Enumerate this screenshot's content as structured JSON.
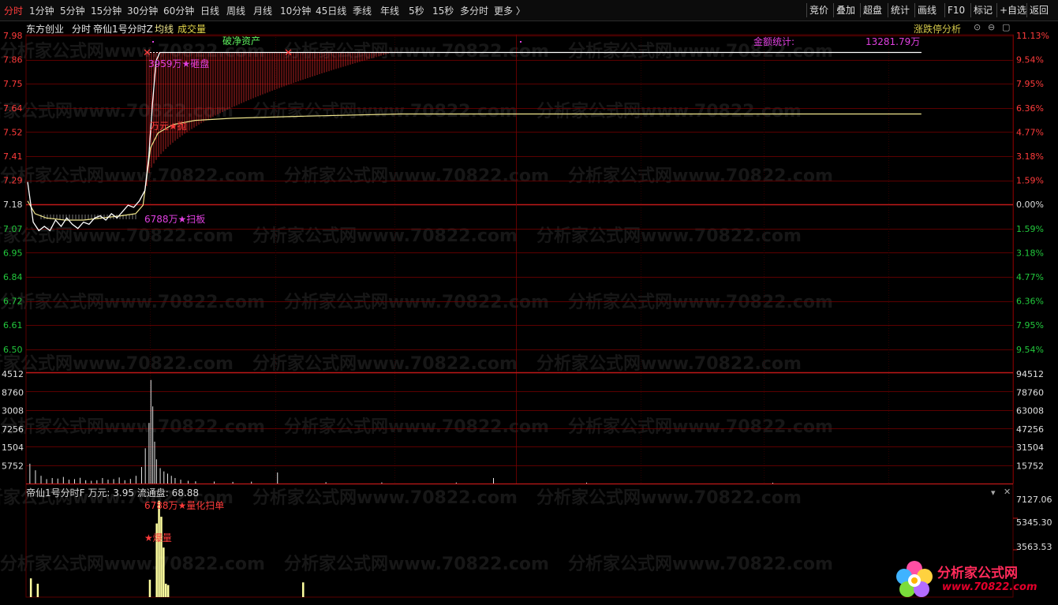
{
  "toolbar": {
    "periods": [
      {
        "label": "分时",
        "active": true
      },
      {
        "label": "1分钟"
      },
      {
        "label": "5分钟"
      },
      {
        "label": "15分钟"
      },
      {
        "label": "30分钟"
      },
      {
        "label": "60分钟"
      },
      {
        "label": "日线"
      },
      {
        "label": "周线"
      },
      {
        "label": "月线"
      },
      {
        "label": "10分钟"
      },
      {
        "label": "45日线"
      },
      {
        "label": "季线"
      },
      {
        "label": "年线"
      },
      {
        "label": "5秒"
      },
      {
        "label": "15秒"
      },
      {
        "label": "多分时"
      },
      {
        "label": "更多 〉"
      }
    ],
    "right_buttons": [
      "竞价",
      "叠加",
      "超盘",
      "统计",
      "画线",
      "F10",
      "标记",
      "+自选",
      "返回"
    ]
  },
  "info": {
    "stock_name": "东方创业",
    "view": "分时",
    "indicator": "帝仙1号分时Z",
    "avg_label": "均线",
    "vol_label": "成交量",
    "right_label": "涨跌停分析"
  },
  "price_axis": {
    "left": [
      "7.98",
      "7.86",
      "7.75",
      "7.64",
      "7.52",
      "7.41",
      "7.29",
      "7.18",
      "7.07",
      "6.95",
      "6.84",
      "6.72",
      "6.61",
      "6.50"
    ],
    "right": [
      "11.13%",
      "9.54%",
      "7.95%",
      "6.36%",
      "4.77%",
      "3.18%",
      "1.59%",
      "0.00%",
      "1.59%",
      "3.18%",
      "4.77%",
      "6.36%",
      "7.95%",
      "9.54%"
    ],
    "prev_close": 7.18
  },
  "volume_axis": {
    "left": [
      "4512",
      "8760",
      "3008",
      "7256",
      "1504",
      "5752"
    ],
    "right": [
      "94512",
      "78760",
      "63008",
      "47256",
      "31504",
      "15752"
    ]
  },
  "sub_axis": {
    "right": [
      "7127.06",
      "5345.30",
      "3563.53"
    ]
  },
  "annotations": {
    "top_sell": "3959万★砸盘",
    "mid_sell": "万元★抛",
    "sweep": "6788万★扫板",
    "break_net": "破净资产",
    "amount_label": "金额统计:",
    "amount_value": "13281.79万",
    "sub_sweep": "6788万★量化扫单",
    "sub_burst": "★爆量"
  },
  "sub_header": {
    "name": "帝仙1号分时F",
    "unit_label": "万元:",
    "unit_value": "3.95",
    "float_label": "流通盘:",
    "float_value": "68.88"
  },
  "watermark": "分析家公式网www.70822.com",
  "logo": {
    "line1": "分析家公式网",
    "line2": "www.70822.com"
  },
  "colors": {
    "up": "#ff3b3b",
    "down": "#22c83c",
    "grid": "#7a0000",
    "price": "#ffffff",
    "avg": "#f0e68c",
    "magenta": "#e040e0"
  },
  "chart_data": {
    "type": "line",
    "x_index_range": [
      0,
      240
    ],
    "prev_close": 7.18,
    "ylim": [
      6.5,
      7.98
    ],
    "series": [],
    "price_points": [
      [
        0,
        7.29
      ],
      [
        3,
        7.1
      ],
      [
        6,
        7.06
      ],
      [
        9,
        7.08
      ],
      [
        12,
        7.06
      ],
      [
        15,
        7.11
      ],
      [
        18,
        7.08
      ],
      [
        21,
        7.12
      ],
      [
        24,
        7.09
      ],
      [
        27,
        7.07
      ],
      [
        30,
        7.1
      ],
      [
        33,
        7.09
      ],
      [
        36,
        7.12
      ],
      [
        39,
        7.13
      ],
      [
        42,
        7.11
      ],
      [
        45,
        7.14
      ],
      [
        48,
        7.12
      ],
      [
        51,
        7.15
      ],
      [
        54,
        7.18
      ],
      [
        57,
        7.17
      ],
      [
        60,
        7.2
      ],
      [
        63,
        7.25
      ],
      [
        65,
        7.4
      ],
      [
        67,
        7.65
      ],
      [
        69,
        7.86
      ],
      [
        71,
        7.9
      ],
      [
        240,
        7.9
      ]
    ],
    "avg_points": [
      [
        0,
        7.2
      ],
      [
        4,
        7.14
      ],
      [
        10,
        7.12
      ],
      [
        20,
        7.11
      ],
      [
        30,
        7.11
      ],
      [
        40,
        7.12
      ],
      [
        50,
        7.13
      ],
      [
        58,
        7.14
      ],
      [
        62,
        7.18
      ],
      [
        66,
        7.45
      ],
      [
        70,
        7.52
      ],
      [
        78,
        7.56
      ],
      [
        90,
        7.58
      ],
      [
        110,
        7.59
      ],
      [
        150,
        7.6
      ],
      [
        200,
        7.61
      ],
      [
        240,
        7.61
      ]
    ],
    "volume_bars": [
      [
        1,
        18000
      ],
      [
        4,
        12000
      ],
      [
        7,
        7000
      ],
      [
        10,
        4000
      ],
      [
        13,
        5000
      ],
      [
        16,
        4500
      ],
      [
        19,
        6000
      ],
      [
        22,
        3500
      ],
      [
        25,
        4000
      ],
      [
        28,
        5200
      ],
      [
        31,
        3000
      ],
      [
        34,
        2500
      ],
      [
        37,
        3000
      ],
      [
        40,
        5000
      ],
      [
        43,
        3500
      ],
      [
        46,
        4000
      ],
      [
        49,
        5500
      ],
      [
        52,
        3000
      ],
      [
        55,
        4200
      ],
      [
        58,
        7000
      ],
      [
        61,
        15000
      ],
      [
        63,
        32000
      ],
      [
        65,
        55000
      ],
      [
        66,
        94000
      ],
      [
        67,
        70000
      ],
      [
        68,
        38000
      ],
      [
        69,
        22000
      ],
      [
        71,
        14000
      ],
      [
        73,
        11000
      ],
      [
        75,
        9000
      ],
      [
        77,
        7000
      ],
      [
        79,
        5000
      ],
      [
        82,
        3500
      ],
      [
        86,
        2500
      ],
      [
        90,
        2000
      ],
      [
        100,
        1800
      ],
      [
        110,
        1500
      ],
      [
        120,
        1700
      ],
      [
        134,
        10000
      ],
      [
        160,
        1200
      ],
      [
        190,
        1000
      ],
      [
        230,
        900
      ],
      [
        250,
        5000
      ],
      [
        300,
        800
      ],
      [
        400,
        700
      ]
    ],
    "sub_bars": [
      [
        1,
        1400
      ],
      [
        4,
        1000
      ],
      [
        53,
        1300
      ],
      [
        56,
        5500
      ],
      [
        57,
        7200
      ],
      [
        58,
        6000
      ],
      [
        59,
        3700
      ],
      [
        60,
        1000
      ],
      [
        61,
        900
      ],
      [
        120,
        1100
      ]
    ]
  }
}
